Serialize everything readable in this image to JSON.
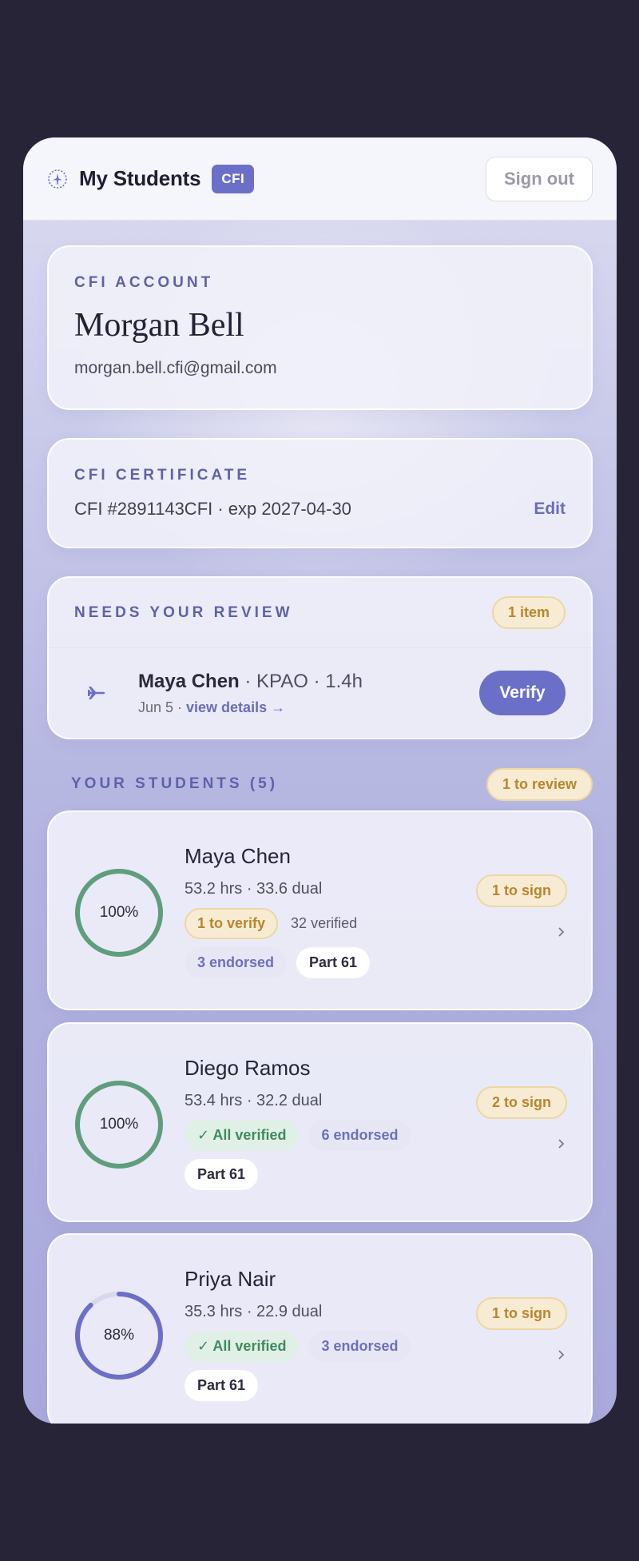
{
  "header": {
    "title": "My Students",
    "badge": "CFI",
    "signout_label": "Sign out"
  },
  "account": {
    "eyebrow": "CFI ACCOUNT",
    "name": "Morgan Bell",
    "email": "morgan.bell.cfi@gmail.com"
  },
  "certificate": {
    "eyebrow": "CFI CERTIFICATE",
    "text": "CFI #2891143CFI · exp 2027-04-30",
    "edit_label": "Edit"
  },
  "review": {
    "eyebrow": "NEEDS YOUR REVIEW",
    "count_label": "1 item",
    "item": {
      "student": "Maya Chen",
      "details": " · KPAO · 1.4h",
      "date": "Jun 5 · ",
      "link": "view details →",
      "verify_label": "Verify"
    }
  },
  "students_section": {
    "title": "YOUR STUDENTS (5)",
    "review_label": "1 to review"
  },
  "students": [
    {
      "name": "Maya Chen",
      "hours": "53.2 hrs · 33.6 dual",
      "progress": 100,
      "progress_label": "100%",
      "sign_label": "1 to sign",
      "verify_chip": "1 to verify",
      "verified_text": "32 verified",
      "endorsed": "3 endorsed",
      "part": "Part 61"
    },
    {
      "name": "Diego Ramos",
      "hours": "53.4 hrs · 32.2 dual",
      "progress": 100,
      "progress_label": "100%",
      "sign_label": "2 to sign",
      "verified_chip": "✓ All verified",
      "endorsed": "6 endorsed",
      "part": "Part 61"
    },
    {
      "name": "Priya Nair",
      "hours": "35.3 hrs · 22.9 dual",
      "progress": 88,
      "progress_label": "88%",
      "sign_label": "1 to sign",
      "verified_chip": "✓ All verified",
      "endorsed": "3 endorsed",
      "part": "Part 61"
    }
  ],
  "colors": {
    "accent": "#6c6fc7",
    "complete_ring": "#5e9e7c",
    "partial_ring": "#6c6fc7",
    "amber": "#b8852f"
  },
  "icons": {
    "logo": "compass-plane-icon",
    "review_item": "airplane-icon",
    "row_action": "chevron-right-icon"
  }
}
